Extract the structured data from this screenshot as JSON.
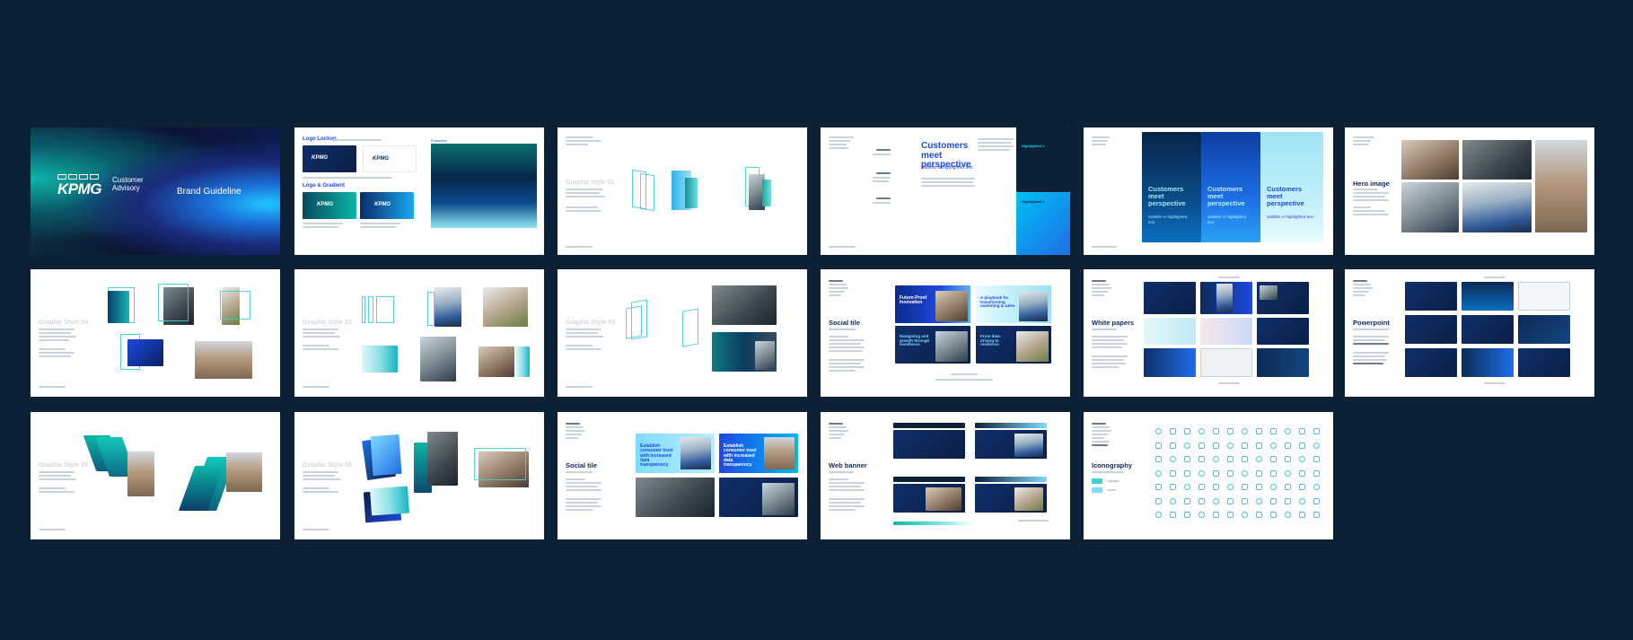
{
  "cover": {
    "logo": "KPMG",
    "logo_sub_1": "Customer",
    "logo_sub_2": "Advisory",
    "title": "Brand Guideline"
  },
  "slides": {
    "logo": {
      "heading_lockup": "Logo Lockup",
      "heading_gradient": "Logo & Gradient",
      "examples_label": "Examples",
      "mini_logo": "KPMG"
    },
    "graphic_style_01": {
      "title": "Graphic style 01"
    },
    "graphic_style_02": {
      "title": "Graphic Style 02"
    },
    "graphic_style_03": {
      "title": "Graphic Style 03"
    },
    "graphic_style_04": {
      "title": "Graphic Style 04"
    },
    "graphic_style_05": {
      "title": "Graphic Style 05"
    },
    "graphic_style_06": {
      "title": "Graphic Style 06"
    },
    "headline": {
      "title": "Customers meet perspective",
      "subtitle": "Subtitle or highlighted text",
      "side_label_1": "Highlighted 1",
      "side_label_2": "Highlighted 2"
    },
    "three_panel": {
      "panels": [
        {
          "title": "Customers meet perspective",
          "subtitle": "Subtitle or highlighted text"
        },
        {
          "title": "Customers meet perspective",
          "subtitle": "Subtitle or highlighted text"
        },
        {
          "title": "Customers meet perspective",
          "subtitle": "Subtitle or highlighted text"
        }
      ]
    },
    "hero_image": {
      "title": "Hero image"
    },
    "social_tile": {
      "title": "Social tile",
      "tiles": [
        "Future-Proof Innovation",
        "A playbook for transforming marketing & sales",
        "Navigating and growth through excellence",
        "From data-driving to resilience"
      ]
    },
    "white_papers": {
      "title": "White papers"
    },
    "powerpoint": {
      "title": "Powerpoint"
    },
    "social_tile_2": {
      "title": "Social tile",
      "tiles": [
        "Establish consumer trust with increased data transparency",
        "Establish consumer trust with increased data transparency"
      ]
    },
    "web_banner": {
      "title": "Web banner"
    },
    "iconography": {
      "title": "Iconography"
    }
  }
}
